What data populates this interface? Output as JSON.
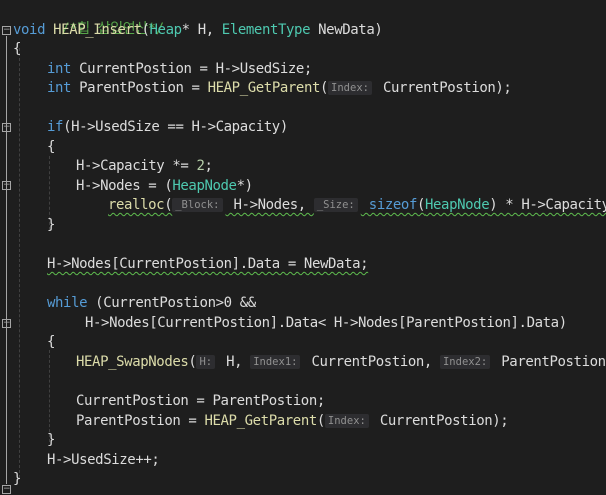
{
  "comment_top": "/*힙 삽입연산*/",
  "lines": {
    "l2": {
      "k": "void",
      "fn": "HEAP_Insert",
      "open": "(",
      "t1": "Heap",
      "star": "* H, ",
      "t2": "ElementType",
      "rest": " NewData)"
    },
    "l3": "{",
    "l4": {
      "k": "int",
      "rest": " CurrentPostion = H->UsedSize;"
    },
    "l5": {
      "k": "int",
      "mid": " ParentPostion = ",
      "fn": "HEAP_GetParent",
      "open": "(",
      "hint": "Index:",
      "rest": " CurrentPostion);"
    },
    "l7": {
      "k": "if",
      "rest": "(H->UsedSize == H->Capacity)"
    },
    "l8": "{",
    "l9": {
      "a": "H->Capacity *= ",
      "num": "2",
      "b": ";"
    },
    "l10": {
      "a": "H->Nodes = (",
      "t": "HeapNode",
      "b": "*)"
    },
    "l11": {
      "fn": "realloc",
      "open": "(",
      "hint1": "_Block:",
      "mid": " H->Nodes, ",
      "hint2": "_Size:",
      "kw": " sizeof",
      "open2": "(",
      "t": "HeapNode",
      "rest": ") * H->Capacity);"
    },
    "l12": "}",
    "l14": {
      "a": "H->Nodes[CurrentPostion].Data = NewData;"
    },
    "l16": {
      "k": "while",
      "rest": " (CurrentPostion>0 &&"
    },
    "l17": {
      "rest": "H->Nodes[CurrentPostion].Data< H->Nodes[ParentPostion].Data)"
    },
    "l18": "{",
    "l19": {
      "fn": "HEAP_SwapNodes",
      "open": "(",
      "hint1": "H:",
      "a": " H, ",
      "hint2": "Index1:",
      "b": " CurrentPostion, ",
      "hint3": "Index2:",
      "c": " ParentPostion);"
    },
    "l21": {
      "rest": "CurrentPostion = ParentPostion;"
    },
    "l22": {
      "mid": "ParentPostion = ",
      "fn": "HEAP_GetParent",
      "open": "(",
      "hint": "Index:",
      "rest": " CurrentPostion);"
    },
    "l23": "}",
    "l24": {
      "rest": "H->UsedSize++;"
    },
    "l25": "}"
  },
  "fold_markers": [
    "−",
    "−",
    "−",
    "−",
    "−"
  ],
  "colors": {
    "background": "#1e1e1e",
    "keyword": "#569cd6",
    "type": "#4ec9b0",
    "function": "#dcdcaa",
    "comment": "#57a64a",
    "number": "#b5cea8"
  }
}
